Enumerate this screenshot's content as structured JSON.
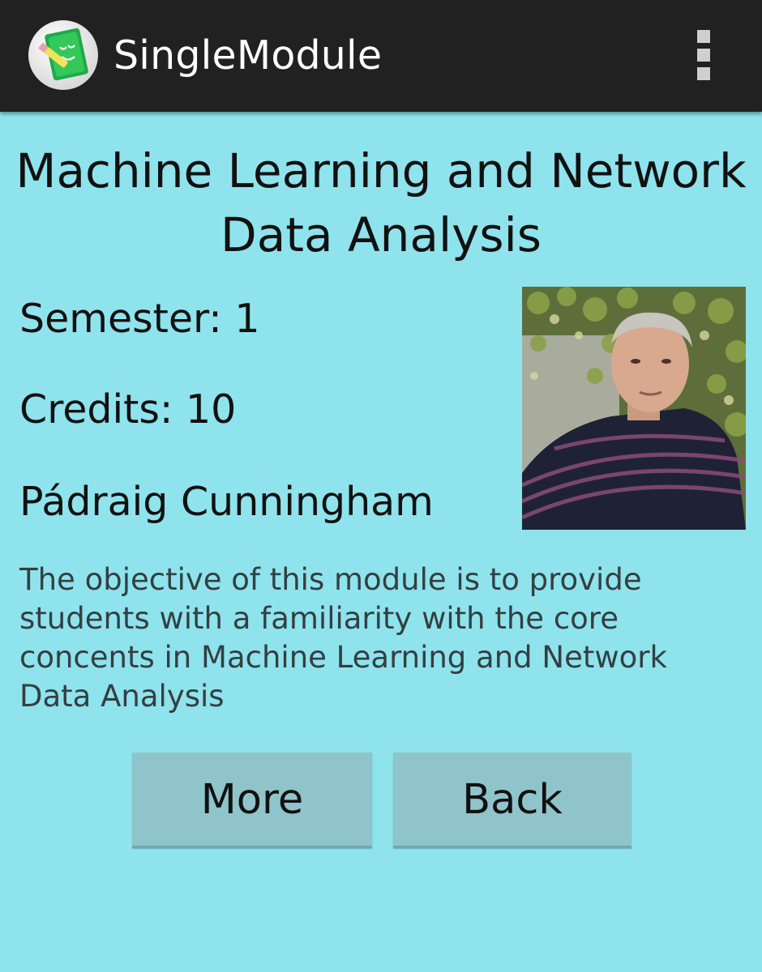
{
  "action_bar": {
    "app_title": "SingleModule",
    "app_icon": "notebook-pencil-icon",
    "overflow_icon": "overflow-menu-icon",
    "background": "#212121"
  },
  "module": {
    "title": "Machine Learning and Network Data Analysis",
    "semester": "Semester: 1",
    "credits": "Credits: 10",
    "lecturer": "Pádraig Cunningham",
    "lecturer_photo": "lecturer-photo",
    "description": "The objective of this module is to provide students with a familiarity with the core concents in Machine Learning and Network Data Analysis"
  },
  "buttons": {
    "more_label": "More",
    "back_label": "Back"
  },
  "colors": {
    "background": "#8fe3ec",
    "button": "#8fc4cb"
  }
}
